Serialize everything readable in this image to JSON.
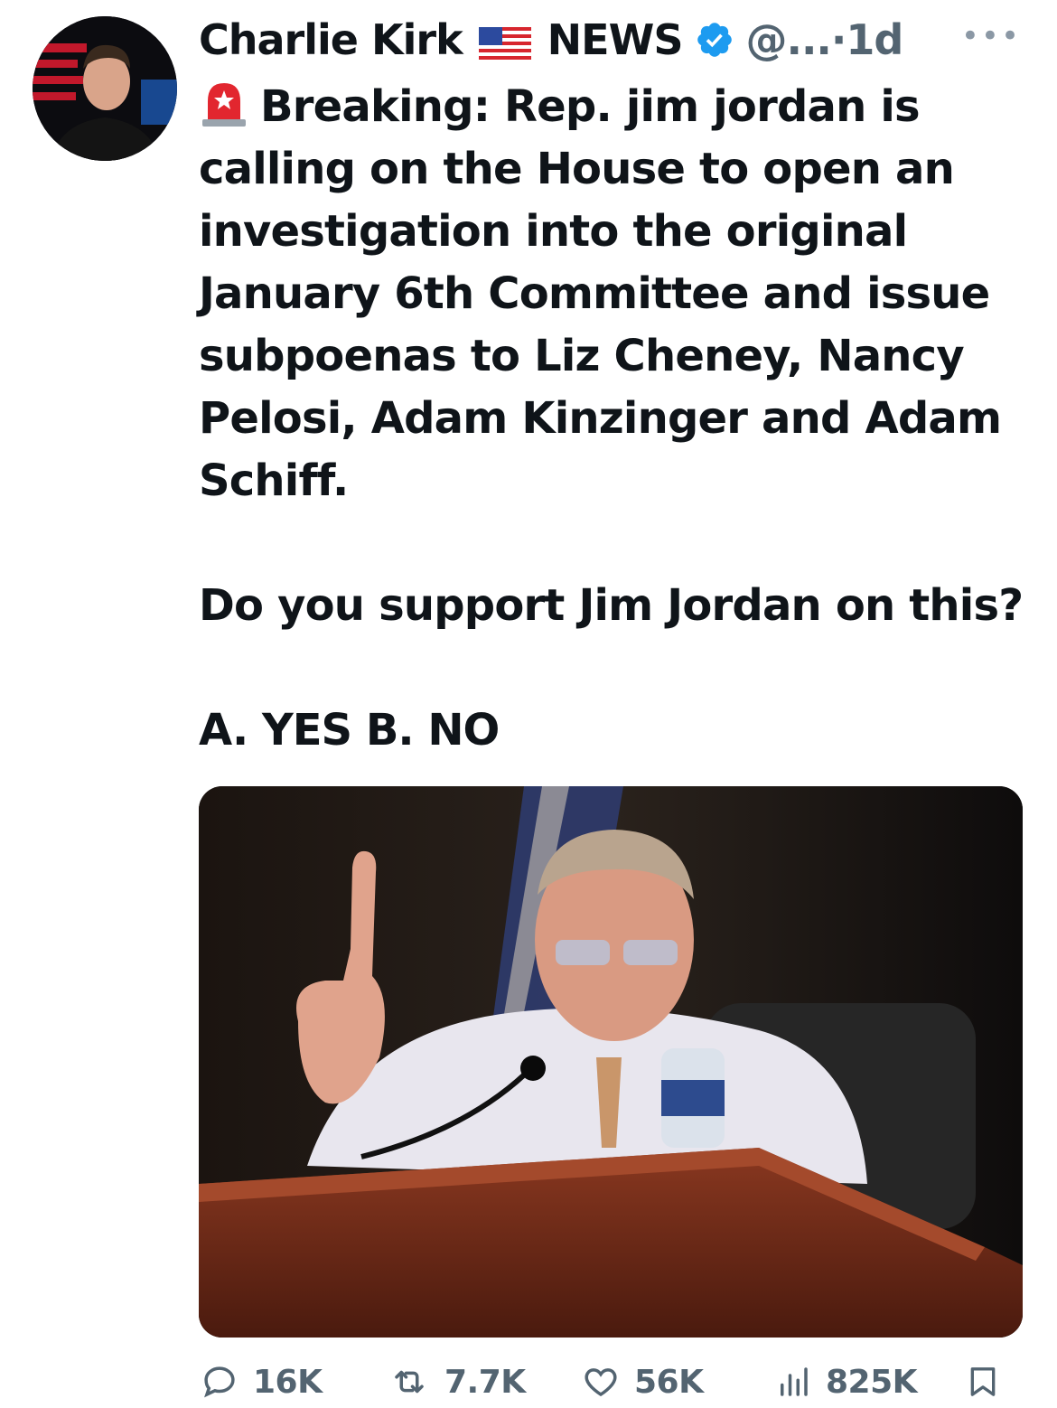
{
  "author": {
    "name": "Charlie Kirk",
    "flag_icon": "us-flag-icon",
    "badge": "NEWS",
    "verified_icon": "verified-badge-icon",
    "handle": "@...",
    "separator": "·",
    "time": "1d",
    "more_icon": "more-options-icon"
  },
  "tweet": {
    "siren_icon": "police-siren-icon",
    "text": "Breaking: Rep. jim jordan is\ncalling on the House to open an\ninvestigation into the original\nJanuary 6th Committee and issue\nsubpoenas to Liz Cheney, Nancy\nPelosi, Adam Kinzinger and Adam\nSchiff.",
    "question": "Do you support Jim Jordan on this?",
    "options": "A. YES B. NO"
  },
  "media": {
    "type": "photo"
  },
  "actions": {
    "replies": "16K",
    "retweets": "7.7K",
    "likes": "56K",
    "views": "825K"
  },
  "colors": {
    "text": "#0f1419",
    "secondary": "#536471",
    "verified": "#1d9bf0"
  }
}
